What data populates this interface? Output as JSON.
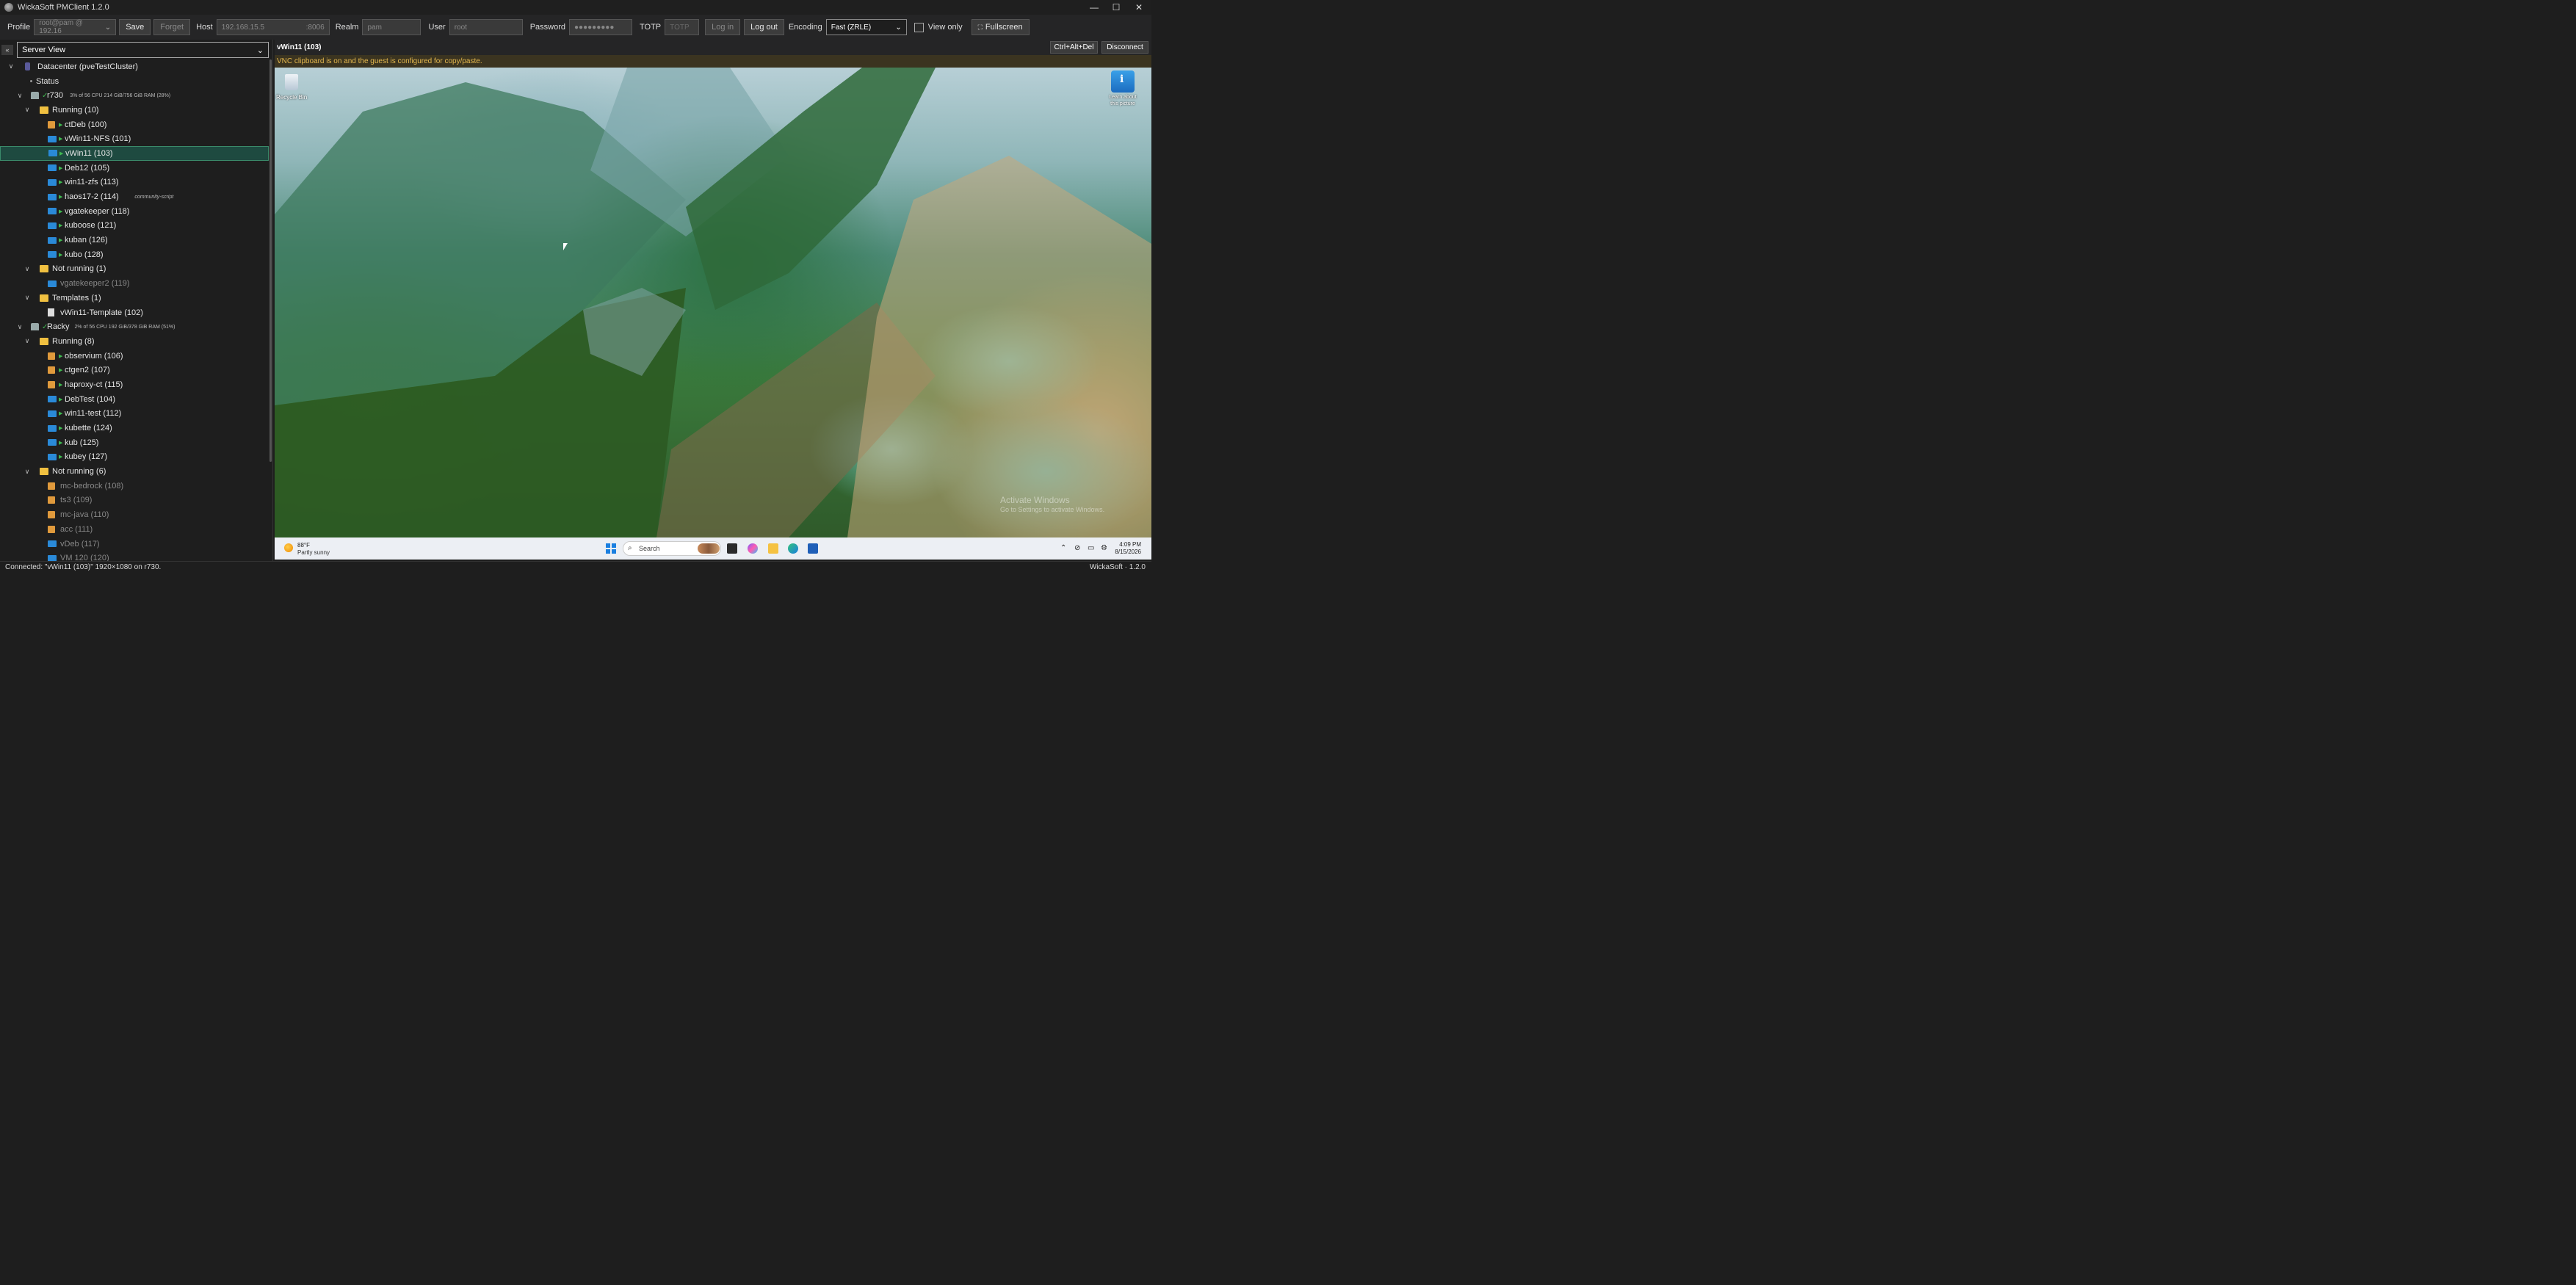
{
  "window": {
    "title": "WickaSoft PMClient 1.2.0",
    "minimize": "—",
    "maximize": "☐",
    "close": "✕"
  },
  "toolbar": {
    "profile_label": "Profile",
    "profile_value": "root@pam @ 192.16",
    "save": "Save",
    "forget": "Forget",
    "host_label": "Host",
    "host_value": "192.168.15.5",
    "host_port": ":8006",
    "realm_label": "Realm",
    "realm_placeholder": "pam",
    "user_label": "User",
    "user_placeholder": "root",
    "password_label": "Password",
    "password_value": "●●●●●●●●●",
    "totp_label": "TOTP",
    "totp_placeholder": "TOTP",
    "login": "Log in",
    "logout": "Log out",
    "encoding_label": "Encoding",
    "encoding_value": "Fast (ZRLE)",
    "view_only": "View only",
    "fullscreen": "Fullscreen"
  },
  "sidebar": {
    "collapse": "«",
    "view_select": "Server View",
    "tree": [
      {
        "level": 0,
        "kind": "dc",
        "label": "Datacenter (pveTestCluster)",
        "chev": "∨"
      },
      {
        "level": 1,
        "kind": "dot",
        "label": "Status"
      },
      {
        "level": 1,
        "kind": "node",
        "label": "r730",
        "check": true,
        "meta": "3% of 56 CPU    214 GiB/756 GiB RAM (28%)",
        "chev": "∨"
      },
      {
        "level": 2,
        "kind": "folder",
        "label": "Running (10)",
        "chev": "∨"
      },
      {
        "level": 3,
        "kind": "ct",
        "label": "ctDeb (100)",
        "play": true
      },
      {
        "level": 3,
        "kind": "vm",
        "label": "vWin11-NFS (101)",
        "play": true
      },
      {
        "level": 3,
        "kind": "vm",
        "label": "vWin11 (103)",
        "play": true,
        "selected": true
      },
      {
        "level": 3,
        "kind": "vm",
        "label": "Deb12 (105)",
        "play": true
      },
      {
        "level": 3,
        "kind": "vm",
        "label": "win11-zfs (113)",
        "play": true
      },
      {
        "level": 3,
        "kind": "vm",
        "label": "haos17-2 (114)",
        "play": true,
        "tag": "community-script"
      },
      {
        "level": 3,
        "kind": "vm",
        "label": "vgatekeeper (118)",
        "play": true
      },
      {
        "level": 3,
        "kind": "vm",
        "label": "kuboose (121)",
        "play": true
      },
      {
        "level": 3,
        "kind": "vm",
        "label": "kuban (126)",
        "play": true
      },
      {
        "level": 3,
        "kind": "vm",
        "label": "kubo (128)",
        "play": true
      },
      {
        "level": 2,
        "kind": "folder",
        "label": "Not running (1)",
        "chev": "∨"
      },
      {
        "level": 3,
        "kind": "vm",
        "label": "vgatekeeper2 (119)",
        "dim": true
      },
      {
        "level": 2,
        "kind": "folder",
        "label": "Templates (1)",
        "chev": "∨"
      },
      {
        "level": 3,
        "kind": "tpl",
        "label": "vWin11-Template (102)"
      },
      {
        "level": 1,
        "kind": "node",
        "label": "Racky",
        "check": true,
        "meta": "2% of 56 CPU    192 GiB/378 GiB RAM (51%)",
        "chev": "∨"
      },
      {
        "level": 2,
        "kind": "folder",
        "label": "Running (8)",
        "chev": "∨"
      },
      {
        "level": 3,
        "kind": "ct",
        "label": "observium (106)",
        "play": true
      },
      {
        "level": 3,
        "kind": "ct",
        "label": "ctgen2 (107)",
        "play": true
      },
      {
        "level": 3,
        "kind": "ct",
        "label": "haproxy-ct (115)",
        "play": true
      },
      {
        "level": 3,
        "kind": "vm",
        "label": "DebTest (104)",
        "play": true
      },
      {
        "level": 3,
        "kind": "vm",
        "label": "win11-test (112)",
        "play": true
      },
      {
        "level": 3,
        "kind": "vm",
        "label": "kubette (124)",
        "play": true
      },
      {
        "level": 3,
        "kind": "vm",
        "label": "kub (125)",
        "play": true
      },
      {
        "level": 3,
        "kind": "vm",
        "label": "kubey (127)",
        "play": true
      },
      {
        "level": 2,
        "kind": "folder",
        "label": "Not running (6)",
        "chev": "∨"
      },
      {
        "level": 3,
        "kind": "ct",
        "label": "mc-bedrock (108)",
        "dim": true
      },
      {
        "level": 3,
        "kind": "ct",
        "label": "ts3 (109)",
        "dim": true
      },
      {
        "level": 3,
        "kind": "ct",
        "label": "mc-java (110)",
        "dim": true
      },
      {
        "level": 3,
        "kind": "ct",
        "label": "acc (111)",
        "dim": true
      },
      {
        "level": 3,
        "kind": "vm",
        "label": "vDeb (117)",
        "dim": true
      },
      {
        "level": 3,
        "kind": "vm",
        "label": "VM 120 (120)",
        "dim": true
      }
    ]
  },
  "vm": {
    "title": "vWin11 (103)",
    "ctrl_alt_del": "Ctrl+Alt+Del",
    "disconnect": "Disconnect",
    "clipboard_notice": "VNC clipboard is on and the guest is configured for copy/paste."
  },
  "desktop": {
    "recycle_bin": "Recycle Bin",
    "learn_line1": "Learn about",
    "learn_line2": "this picture",
    "activate_title": "Activate Windows",
    "activate_sub": "Go to Settings to activate Windows."
  },
  "taskbar": {
    "temp": "88°F",
    "weather": "Partly sunny",
    "search": "Search",
    "time": "4:09 PM",
    "date": "8/15/2026"
  },
  "status": {
    "left": "Connected: \"vWin11 (103)\" 1920×1080 on r730.",
    "right": "WickaSoft · 1.2.0"
  },
  "colors": {
    "accent_green": "#3fb950",
    "selection": "#1e4a40",
    "notice_text": "#e5b84e"
  }
}
